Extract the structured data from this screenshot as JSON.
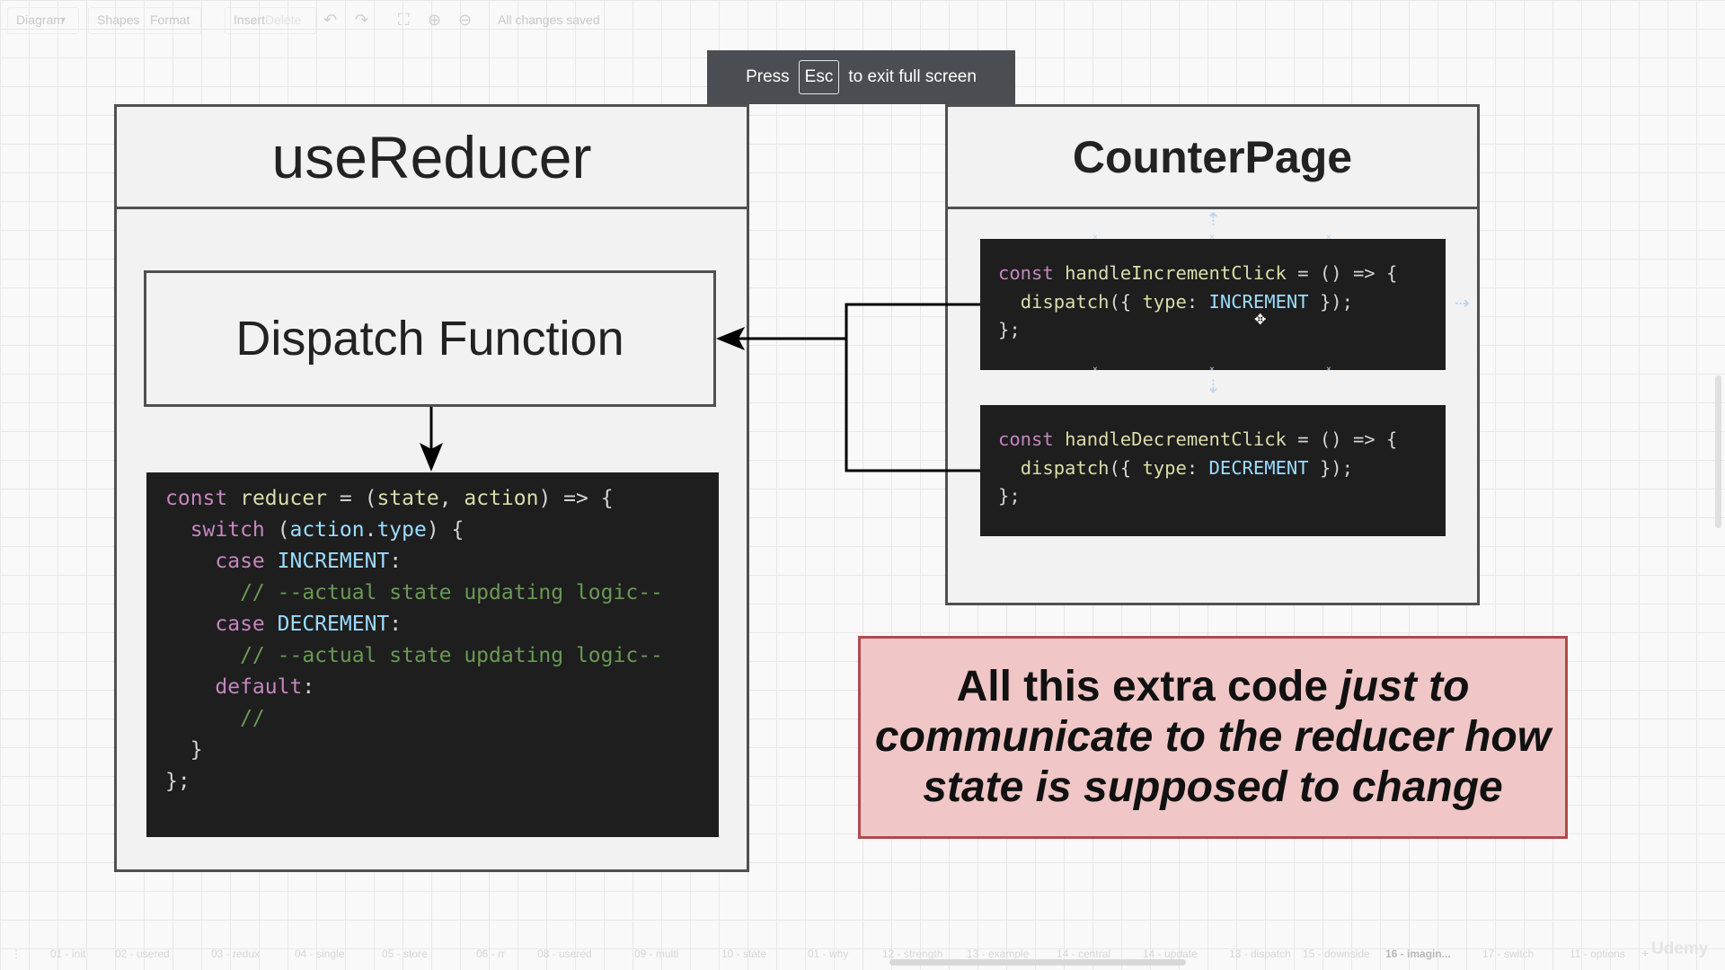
{
  "toolbar": {
    "diagram_menu": "Diagram",
    "shapes": "Shapes",
    "format": "Format",
    "insert": "Insert",
    "delete": "Delete",
    "status": "All changes saved"
  },
  "fullscreen_toast": {
    "before": "Press",
    "key": "Esc",
    "after": "to exit full screen"
  },
  "use_reducer": {
    "title": "useReducer",
    "dispatch_label": "Dispatch Function",
    "code": {
      "l1": {
        "a": "const",
        "b": " ",
        "c": "reducer",
        "d": " = (",
        "e": "state",
        "f": ", ",
        "g": "action",
        "h": ") => {"
      },
      "l2": {
        "a": "  switch",
        "b": " (",
        "c": "action",
        "d": ".",
        "e": "type",
        "f": ") {"
      },
      "l3": {
        "a": "    case",
        "b": " ",
        "c": "INCREMENT",
        "d": ":"
      },
      "l4": "      // --actual state updating logic--",
      "l5": {
        "a": "    case",
        "b": " ",
        "c": "DECREMENT",
        "d": ":"
      },
      "l6": "      // --actual state updating logic--",
      "l7": {
        "a": "    default",
        "b": ":"
      },
      "l8": "      //",
      "l9": "  }",
      "l10": "};"
    }
  },
  "counter_page": {
    "title": "CounterPage",
    "increment_code": {
      "l1": {
        "a": "const",
        "b": " ",
        "c": "handleIncrementClick",
        "d": " = () => {"
      },
      "l2": {
        "a": "  ",
        "b": "dispatch",
        "c": "({ ",
        "d": "type",
        "e": ": ",
        "f": "INCREMENT",
        "g": " });"
      },
      "l3": "};"
    },
    "decrement_code": {
      "l1": {
        "a": "const",
        "b": " ",
        "c": "handleDecrementClick",
        "d": " = () => {"
      },
      "l2": {
        "a": "  ",
        "b": "dispatch",
        "c": "({ ",
        "d": "type",
        "e": ": ",
        "f": "DECREMENT",
        "g": " });"
      },
      "l3": "};"
    }
  },
  "note": {
    "line1_normal": "All this extra code ",
    "line1_italic": "just to",
    "line2": "communicate to the reducer how",
    "line3": "state is supposed to change"
  },
  "page_tabs": [
    "01 - init",
    "02 - usered",
    "03 - redux",
    "04 - single",
    "05 - store",
    "06 - rr",
    "08 - usered",
    "09 - multi",
    "10 - state",
    "01 - why",
    "12 - strength",
    "13 - example",
    "14 - central",
    "14 - update",
    "13 - dispatch",
    "15 - downside",
    "16 - imagin...",
    "17 - switch",
    "11 - options"
  ],
  "watermark": "Udemy",
  "colors": {
    "keyword": "#c586c0",
    "function": "#dcdcaa",
    "variable": "#9cdcfe",
    "comment": "#6a9955",
    "note_bg": "#f0c6c6",
    "note_border": "#b04a4a"
  }
}
